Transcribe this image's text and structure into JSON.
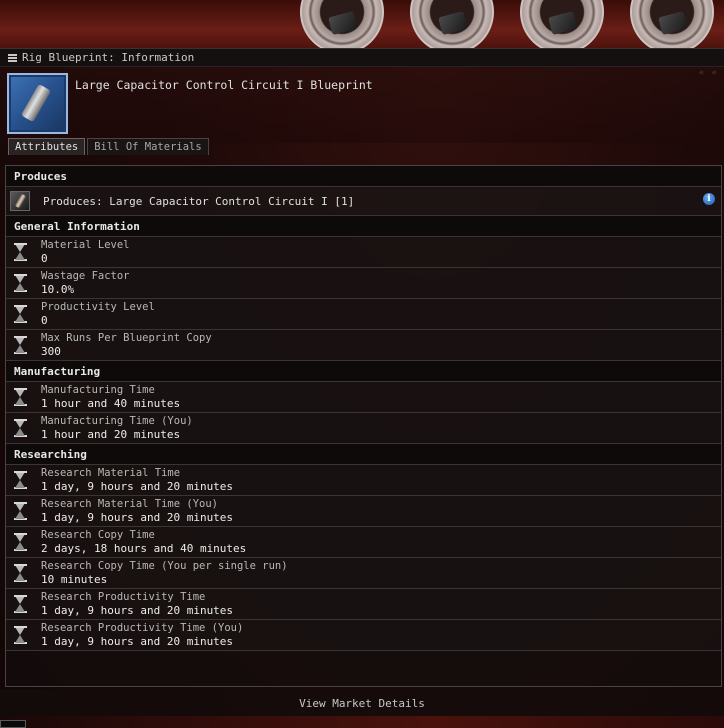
{
  "window": {
    "title": "Rig Blueprint: Information",
    "item_name": "Large Capacitor Control Circuit I Blueprint",
    "controls": "« «"
  },
  "tabs": [
    {
      "label": "Attributes",
      "active": true
    },
    {
      "label": "Bill Of Materials",
      "active": false
    }
  ],
  "produces": {
    "section": "Produces",
    "text": "Produces: Large Capacitor Control Circuit I [1]",
    "info_glyph": "i"
  },
  "general": {
    "section": "General Information",
    "rows": [
      {
        "label": "Material Level",
        "value": "0"
      },
      {
        "label": "Wastage Factor",
        "value": "10.0%"
      },
      {
        "label": "Productivity Level",
        "value": "0"
      },
      {
        "label": "Max Runs Per Blueprint Copy",
        "value": "300"
      }
    ]
  },
  "manufacturing": {
    "section": "Manufacturing",
    "rows": [
      {
        "label": "Manufacturing Time",
        "value": "1 hour and 40 minutes"
      },
      {
        "label": "Manufacturing Time (You)",
        "value": "1 hour and 20 minutes"
      }
    ]
  },
  "researching": {
    "section": "Researching",
    "rows": [
      {
        "label": "Research Material Time",
        "value": "1 day, 9 hours and 20 minutes"
      },
      {
        "label": "Research Material Time (You)",
        "value": "1 day, 9 hours and 20 minutes"
      },
      {
        "label": "Research Copy Time",
        "value": "2 days, 18 hours and 40 minutes"
      },
      {
        "label": "Research Copy Time (You per single run)",
        "value": "10 minutes"
      },
      {
        "label": "Research Productivity Time",
        "value": "1 day, 9 hours and 20 minutes"
      },
      {
        "label": "Research Productivity Time (You)",
        "value": "1 day, 9 hours and 20 minutes"
      }
    ]
  },
  "footer": {
    "market_button": "View Market Details"
  },
  "icons": {
    "menu": "menu-icon",
    "blueprint": "blueprint-icon",
    "produces": "capacitor-circuit-icon",
    "info": "info-icon",
    "attribute": "hourglass-icon"
  },
  "colors": {
    "background": "#2a0a08",
    "panel": "#141010",
    "info_blue": "#1a5ab0",
    "blueprint_blue": "#3d74b8"
  }
}
